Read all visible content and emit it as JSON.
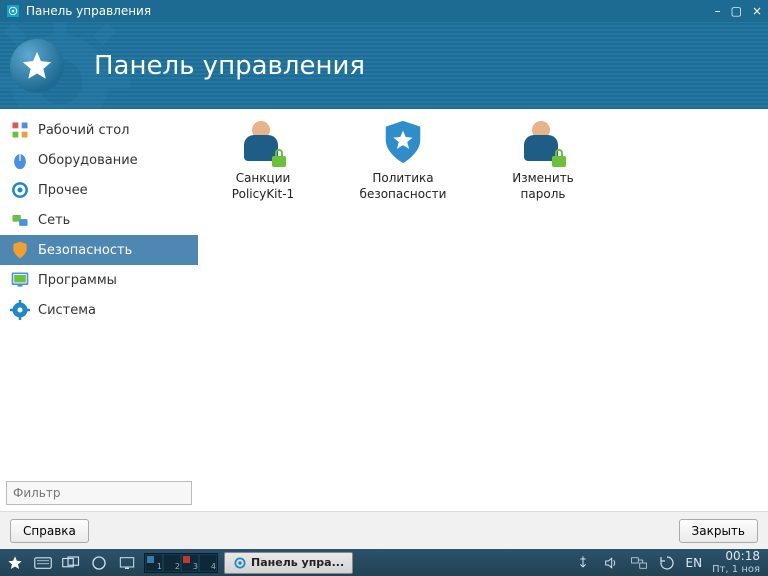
{
  "window": {
    "title": "Панель управления",
    "header_title": "Панель управления"
  },
  "sidebar": {
    "items": [
      {
        "label": "Рабочий стол"
      },
      {
        "label": "Оборудование"
      },
      {
        "label": "Прочее"
      },
      {
        "label": "Сеть"
      },
      {
        "label": "Безопасность"
      },
      {
        "label": "Программы"
      },
      {
        "label": "Система"
      }
    ],
    "filter_placeholder": "Фильтр"
  },
  "tiles": [
    {
      "label": "Санкции PolicyKit-1"
    },
    {
      "label": "Политика безопасности"
    },
    {
      "label": "Изменить пароль"
    }
  ],
  "buttons": {
    "help": "Справка",
    "close": "Закрыть"
  },
  "taskbar": {
    "active_task": "Панель упра...",
    "lang": "EN",
    "time": "00:18",
    "date": "Пт, 1 ноя",
    "pager": [
      "1",
      "2",
      "3",
      "4"
    ]
  }
}
